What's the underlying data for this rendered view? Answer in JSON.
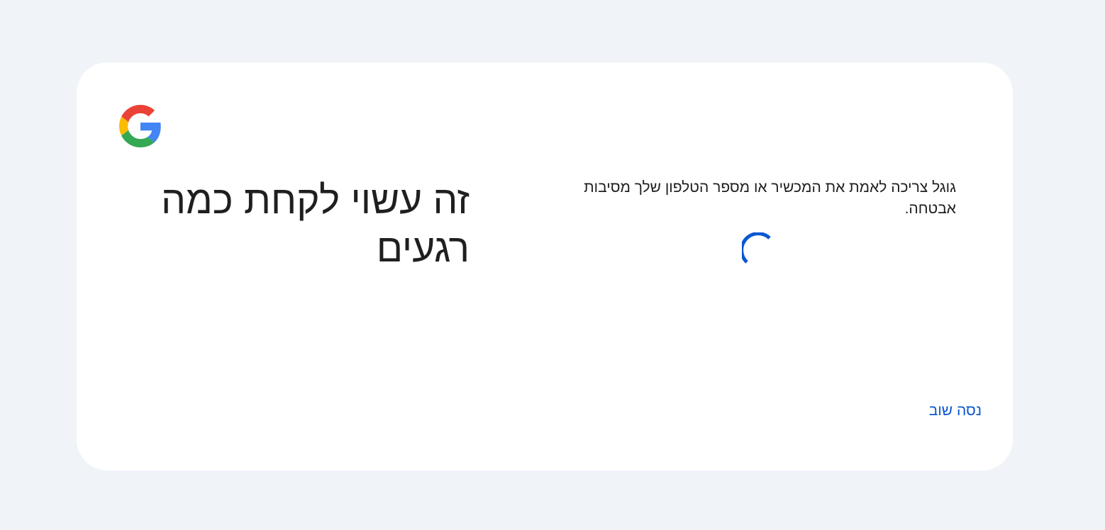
{
  "brand": {
    "logo_icon": "google-g-icon",
    "colors": {
      "red": "#EA4335",
      "yellow": "#FBBC05",
      "green": "#34A853",
      "blue": "#4285F4"
    }
  },
  "card": {
    "title": "זה עשוי לקחת כמה רגעים",
    "message": "גוגל צריכה לאמת את המכשיר או מספר הטלפון שלך מסיבות אבטחה.",
    "loading_icon": "spinner-icon",
    "retry_label": "נסה שוב"
  },
  "colors": {
    "page_background": "#f0f4f9",
    "card_background": "#ffffff",
    "text": "#1f1f1f",
    "accent": "#0b57d0"
  }
}
